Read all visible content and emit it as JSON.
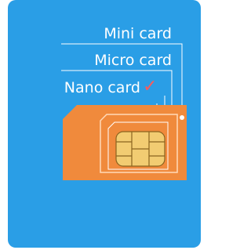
{
  "labels": {
    "mini": "Mini card",
    "micro": "Micro card",
    "nano": "Nano card"
  },
  "check_icon": "✓",
  "colors": {
    "background": "#2a9ee6",
    "card": "#f08a3c",
    "chip": "#f2cc72",
    "line": "#ffffff",
    "check": "#ff5a5a"
  }
}
